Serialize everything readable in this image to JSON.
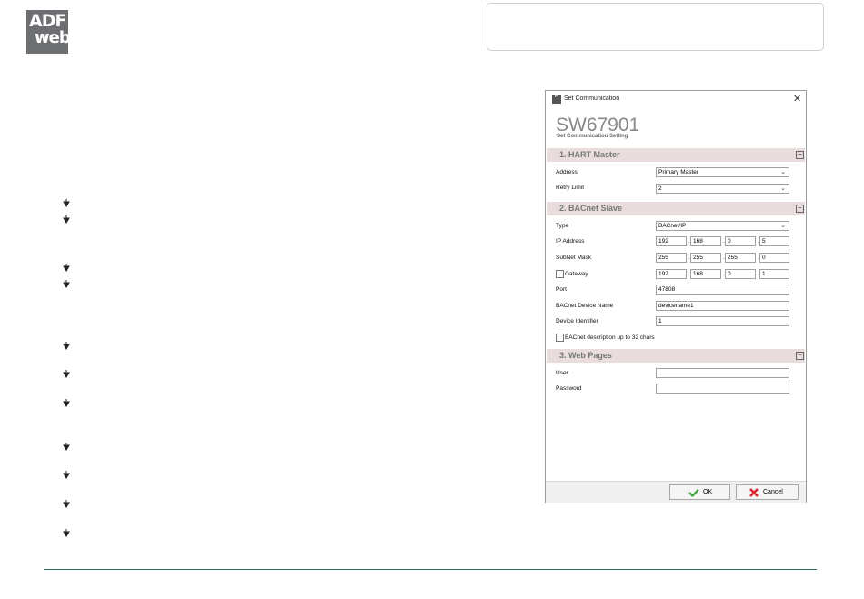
{
  "logo": {
    "line1": "ADF",
    "line2": "web"
  },
  "dialog": {
    "title": "Set Communication",
    "close_glyph": "✕",
    "heading": "SW67901",
    "subheading": "Set Communication Setting",
    "sections": {
      "hart": {
        "title": "1. HART Master",
        "collapse_glyph": "−",
        "address_label": "Address",
        "address_value": "Primary Master",
        "retry_label": "Retry Limit",
        "retry_value": "2"
      },
      "bacnet": {
        "title": "2. BACnet Slave",
        "collapse_glyph": "−",
        "type_label": "Type",
        "type_value": "BACnet/IP",
        "ip_label": "IP Address",
        "ip": [
          "192",
          "168",
          "0",
          "5"
        ],
        "subnet_label": "SubNet Mask",
        "subnet": [
          "255",
          "255",
          "255",
          "0"
        ],
        "gateway_label": "Gateway",
        "gateway": [
          "192",
          "168",
          "0",
          "1"
        ],
        "port_label": "Port",
        "port_value": "47808",
        "device_name_label": "BACnet Device Name",
        "device_name_value": "devicename1",
        "device_id_label": "Device Identifier",
        "device_id_value": "1",
        "desc_checkbox_label": "BACnet description up to 32 chars"
      },
      "web": {
        "title": "3. Web Pages",
        "collapse_glyph": "−",
        "user_label": "User",
        "user_value": "",
        "password_label": "Password",
        "password_value": ""
      }
    },
    "ok_label": "OK",
    "cancel_label": "Cancel",
    "icons": {
      "ok": "check-icon",
      "cancel": "x-icon",
      "dropdown": "chevron-down-icon"
    }
  },
  "colors": {
    "section_bg": "#e9dcdc",
    "ok_check": "#3aa635",
    "cancel_x": "#d9262c",
    "bottom_line": "#2e6e5f"
  }
}
